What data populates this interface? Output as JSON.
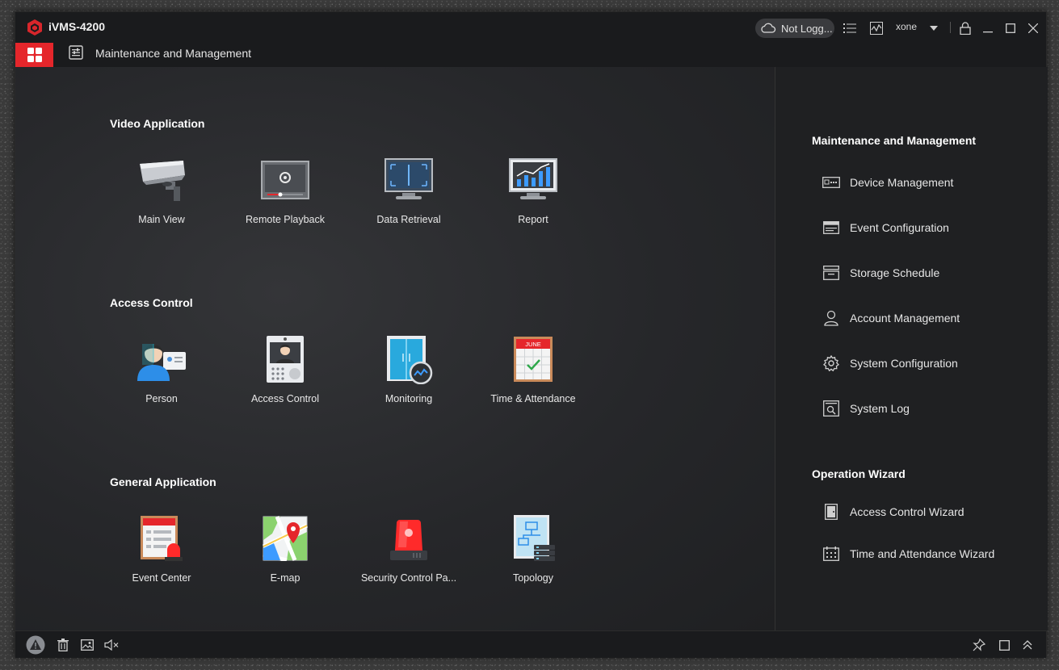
{
  "app": {
    "title": "iVMS-4200"
  },
  "header": {
    "cloud_status": "Not Logg...",
    "user": "xone",
    "tab_label": "Maintenance and Management"
  },
  "colors": {
    "accent": "#e5262b",
    "background": "#1e1f21"
  },
  "sections": {
    "video": {
      "title": "Video Application",
      "items": [
        "Main View",
        "Remote Playback",
        "Data Retrieval",
        "Report"
      ]
    },
    "access": {
      "title": "Access Control",
      "items": [
        "Person",
        "Access Control",
        "Monitoring",
        "Time & Attendance"
      ]
    },
    "general": {
      "title": "General Application",
      "items": [
        "Event Center",
        "E-map",
        "Security Control Pa...",
        "Topology"
      ]
    }
  },
  "sidebar": {
    "maintenance_title": "Maintenance and Management",
    "maintenance_items": [
      "Device Management",
      "Event Configuration",
      "Storage Schedule",
      "Account Management",
      "System Configuration",
      "System Log"
    ],
    "wizard_title": "Operation Wizard",
    "wizard_items": [
      "Access Control Wizard",
      "Time and Attendance Wizard"
    ]
  },
  "calendar_icon_text": "JUNE"
}
